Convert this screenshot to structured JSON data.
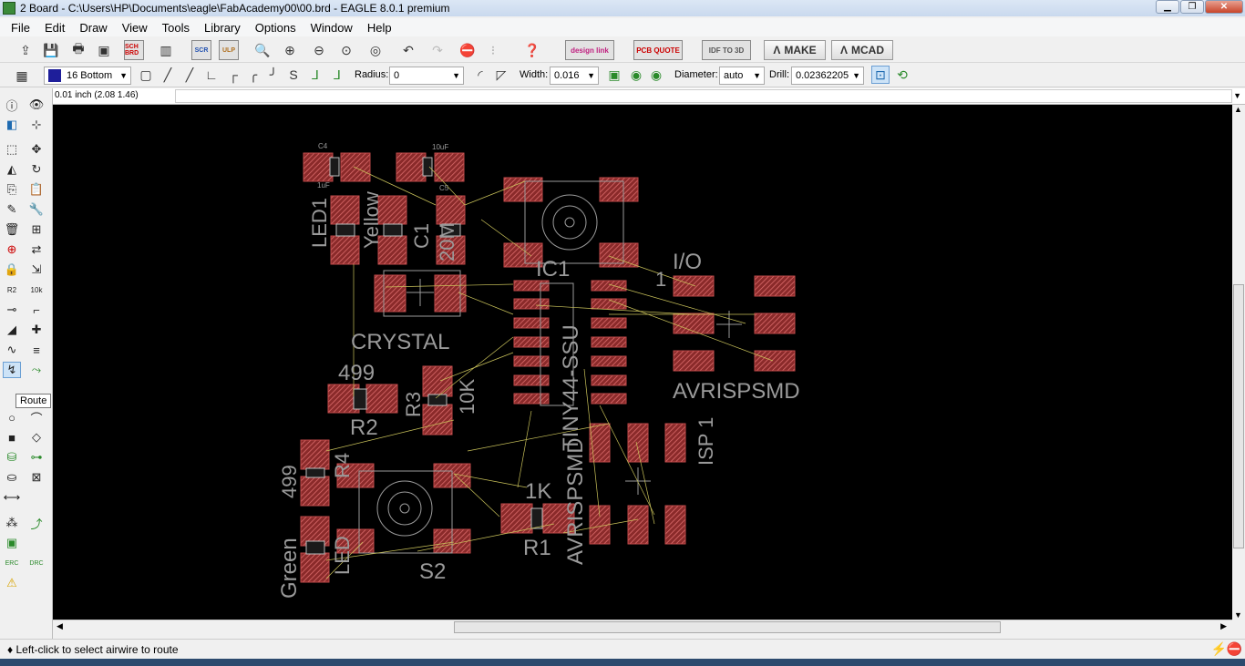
{
  "window": {
    "title": "2 Board - C:\\Users\\HP\\Documents\\eagle\\FabAcademy00\\00.brd - EAGLE 8.0.1 premium"
  },
  "menu": [
    "File",
    "Edit",
    "Draw",
    "View",
    "Tools",
    "Library",
    "Options",
    "Window",
    "Help"
  ],
  "toolbar": {
    "make_label": "MAKE",
    "mcad_label": "MCAD",
    "sch_brd_label": "SCH BRD",
    "scr_label": "SCR",
    "ulp_label": "ULP",
    "designlink_label": "design link",
    "pcb_quote_label": "PCB QUOTE",
    "idf_label": "IDF TO 3D"
  },
  "route_toolbar": {
    "layer": "16 Bottom",
    "radius_label": "Radius:",
    "radius_value": "0",
    "width_label": "Width:",
    "width_value": "0.016",
    "diameter_label": "Diameter:",
    "diameter_value": "auto",
    "drill_label": "Drill:",
    "drill_value": "0.02362205"
  },
  "command_line": {
    "coordinate": "0.01 inch (2.08 1.46)",
    "value": ""
  },
  "left_toolbar": {
    "tooltip": "Route",
    "erc_label": "ERC",
    "drc_label": "DRC"
  },
  "status": {
    "message": "Left-click to select airwire to route"
  },
  "board": {
    "colors": {
      "background": "#000000",
      "pad": "#c04a4a",
      "text": "#9a9a9a",
      "airwire": "#c9c25a"
    },
    "labels": {
      "c4": "C4",
      "uf1": "10uF",
      "uf2": "1uF",
      "c5": "C5",
      "led1": "LED1",
      "yellow": "Yellow",
      "c1": "C1",
      "ghz": "20M",
      "crystal": "CRYSTAL",
      "ic1": "IC1",
      "t1": "1",
      "io": "I/O",
      "avrispsmd": "AVRISPSMD",
      "r499a": "499",
      "r2": "R2",
      "r3": "R3",
      "r10k": "10K",
      "tiny": "TINY44-SSU",
      "isp": "ISP 1",
      "r499b": "499",
      "r4": "R4",
      "green": "Green",
      "led2": "LED",
      "s2": "S2",
      "r1k": "1K",
      "r1": "R1",
      "avr2": "AVRISPSMD"
    }
  }
}
